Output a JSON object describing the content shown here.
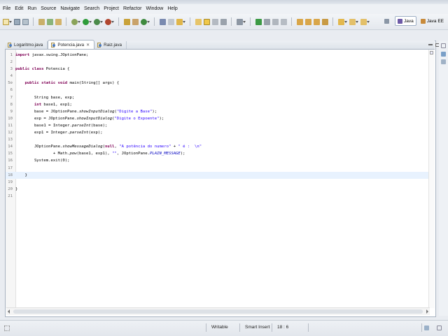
{
  "menu": [
    "File",
    "Edit",
    "Run",
    "Source",
    "Navigate",
    "Search",
    "Project",
    "Refactor",
    "Window",
    "Help"
  ],
  "perspectives": {
    "java": "Java",
    "javaee": "Java EE"
  },
  "tabs": [
    {
      "label": "Logaritmo.java",
      "active": false
    },
    {
      "label": "Potencia.java",
      "active": true,
      "close": "✕"
    },
    {
      "label": "Raiz.java",
      "active": false
    }
  ],
  "code": {
    "line_numbers": [
      "1",
      "2",
      "3",
      "4",
      "5⊖",
      "6",
      "7",
      "8",
      "9",
      "10",
      "11",
      "12",
      "13",
      "14",
      "15",
      "16",
      "17",
      "18",
      "19",
      "20",
      "21"
    ],
    "l1_kw": "import",
    "l1_rest": " javax.swing.JOptionPane;",
    "l3_kw1": "public",
    "l3_kw2": "class",
    "l3_rest": " Potencia {",
    "l5_kw1": "public",
    "l5_kw2": "static",
    "l5_kw3": "void",
    "l5_rest": " main(String[] args) {",
    "l7": "        String base, exp;",
    "l8_kw": "int",
    "l8_rest": " base1, exp1;",
    "l9_pre": "        base = JOptionPane.",
    "l9_method": "showInputDialog",
    "l9_open": "(",
    "l9_str": "\"Digite a Base\"",
    "l9_close": ");",
    "l10_pre": "        exp = JOptionPane.",
    "l10_method": "showInputDialog",
    "l10_open": "(",
    "l10_str": "\"Digite o Expoente\"",
    "l10_close": ");",
    "l11_pre": "        base1 = Integer.",
    "l11_method": "parseInt",
    "l11_close": "(base);",
    "l12_pre": "        exp1 = Integer.",
    "l12_method": "parseInt",
    "l12_close": "(exp);",
    "l14_pre": "        JOptionPane.",
    "l14_method": "showMessageDialog",
    "l14_open": "(",
    "l14_kw": "null",
    "l14_mid": ", ",
    "l14_str1": "\"A potência do numero\"",
    "l14_plus": " + ",
    "l14_str2": "\" é :  \\n\"",
    "l15_pre": "                + Math.",
    "l15_method": "pow",
    "l15_mid": "(base1, exp1), ",
    "l15_str": "\"\"",
    "l15_mid2": ", JOptionPane.",
    "l15_const": "PLAIN_MESSAGE",
    "l15_close": ");",
    "l16": "        System.exit(0);",
    "l18": "    }",
    "l20": "}"
  },
  "status": {
    "writable": "Writable",
    "insert_mode": "Smart Insert",
    "position": "18 : 6"
  },
  "colors": {
    "keyword": "#7f0055",
    "string": "#2a00ff",
    "constant": "#0000c0",
    "current_line": "#e8f2fe"
  }
}
